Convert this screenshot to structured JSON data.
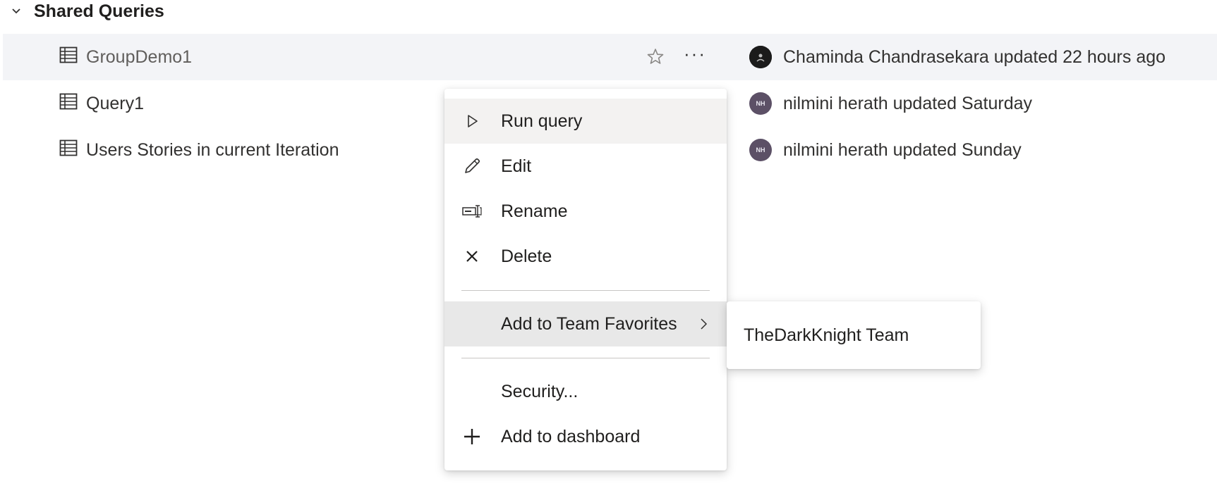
{
  "section": {
    "title": "Shared Queries",
    "chevron_icon": "chevron-down-icon"
  },
  "queries": [
    {
      "name": "GroupDemo1",
      "owner": "Chaminda Chandrasekara updated 22 hours ago",
      "avatar": "",
      "selected": true,
      "favorite_icon": "star-outline-icon",
      "more_label": "···"
    },
    {
      "name": "Query1",
      "owner": "nilmini herath updated Saturday",
      "avatar": "NH"
    },
    {
      "name": "Users Stories in current Iteration",
      "owner": "nilmini herath updated Sunday",
      "avatar": "NH"
    }
  ],
  "context_menu": {
    "items": [
      {
        "label": "Run query",
        "icon": "play-icon"
      },
      {
        "label": "Edit",
        "icon": "pencil-icon"
      },
      {
        "label": "Rename",
        "icon": "rename-icon"
      },
      {
        "label": "Delete",
        "icon": "close-icon"
      },
      {
        "label": "Add to Team Favorites",
        "icon": "chevron-right-icon"
      },
      {
        "label": "Security...",
        "icon": ""
      },
      {
        "label": "Add to dashboard",
        "icon": "plus-icon"
      }
    ]
  },
  "submenu": {
    "items": [
      {
        "label": "TheDarkKnight Team"
      }
    ]
  },
  "colors": {
    "selected_row_bg": "#f3f4f7",
    "menu_hover_bg": "#f3f2f1",
    "menu_active_bg": "#e8e8e8",
    "avatar_nh": "#5c5066",
    "text": "#323130"
  }
}
